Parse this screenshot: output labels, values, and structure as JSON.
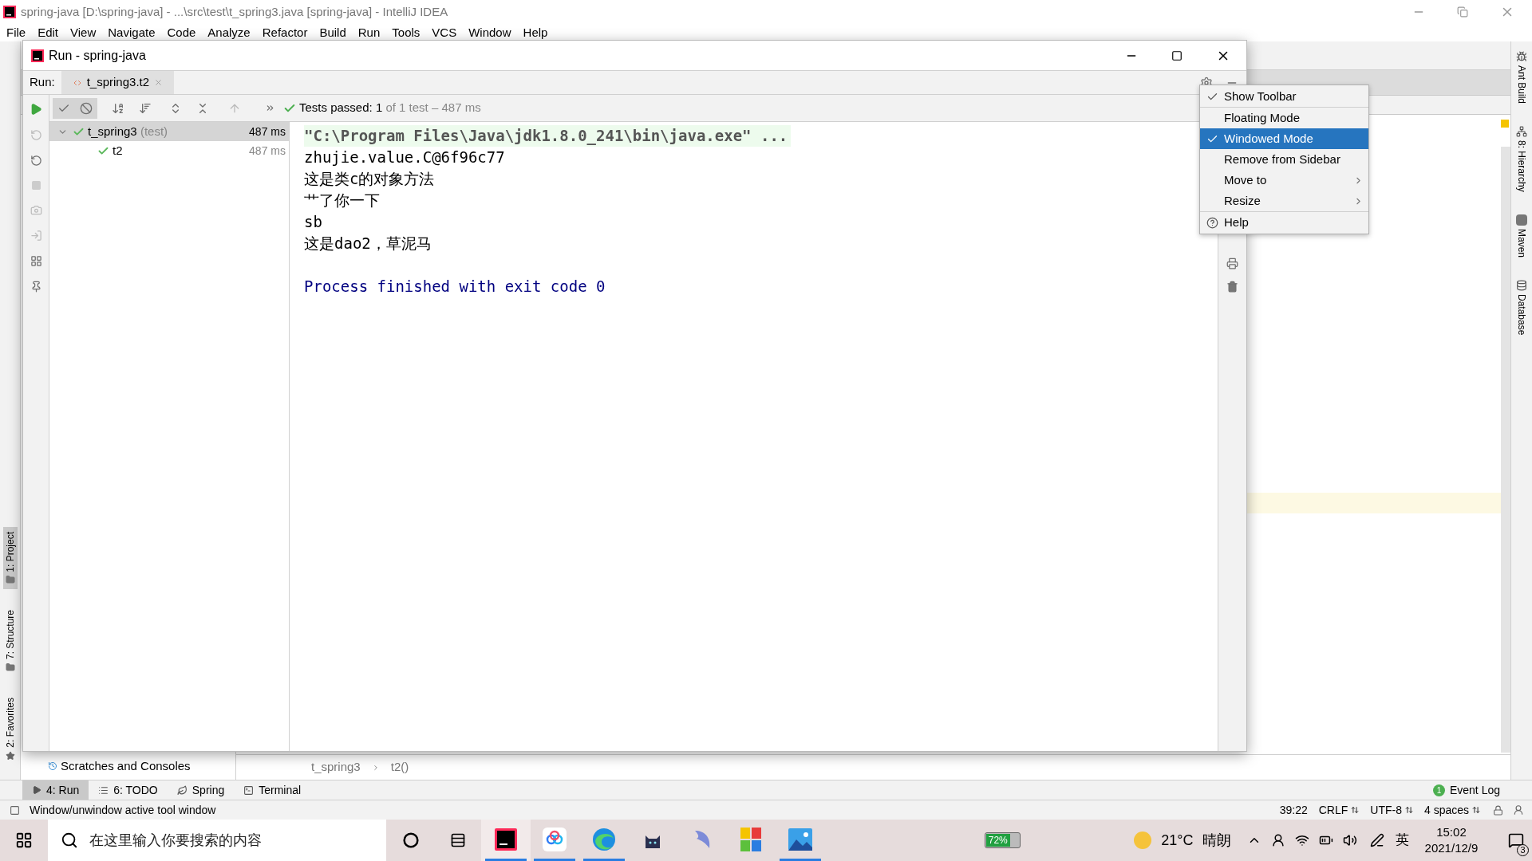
{
  "window": {
    "title": "spring-java [D:\\spring-java] - ...\\src\\test\\t_spring3.java [spring-java] - IntelliJ IDEA"
  },
  "menu": [
    "File",
    "Edit",
    "View",
    "Navigate",
    "Code",
    "Analyze",
    "Refactor",
    "Build",
    "Run",
    "Tools",
    "VCS",
    "Window",
    "Help"
  ],
  "left_stripe": [
    {
      "label": "1: Project",
      "selected": true
    },
    {
      "label": "7: Structure",
      "selected": false
    },
    {
      "label": "2: Favorites",
      "selected": false
    }
  ],
  "right_stripe": [
    {
      "label": "Ant Build",
      "kind": "ant"
    },
    {
      "label": "8: Hierarchy",
      "kind": "hierarchy"
    },
    {
      "label": "Maven",
      "kind": "maven"
    },
    {
      "label": "Database",
      "kind": "database"
    }
  ],
  "project_panel": {
    "item": "Scratches and Consoles"
  },
  "breadcrumbs": [
    "t_spring3",
    "t2()"
  ],
  "run_window": {
    "title": "Run - spring-java",
    "run_label": "Run:",
    "tabs": [
      {
        "label": "t_spring3.t2",
        "selected": true
      }
    ],
    "status": {
      "label": "Tests passed:",
      "count": "1",
      "detail": "of 1 test – 487 ms"
    },
    "tree": [
      {
        "label": "t_spring3",
        "suffix": "(test)",
        "time": "487 ms",
        "selected": true,
        "expanded": true,
        "children": [
          {
            "label": "t2",
            "time": "487 ms",
            "selected": false
          }
        ]
      }
    ],
    "console": [
      {
        "kind": "command",
        "text": "\"C:\\Program Files\\Java\\jdk1.8.0_241\\bin\\java.exe\" ..."
      },
      {
        "kind": "output",
        "text": "zhujie.value.C@6f96c77"
      },
      {
        "kind": "output",
        "text": "这是类c的对象方法"
      },
      {
        "kind": "output",
        "text": "艹了你一下"
      },
      {
        "kind": "output",
        "text": "sb"
      },
      {
        "kind": "output",
        "text": "这是dao2，草泥马"
      },
      {
        "kind": "system",
        "text": "Process finished with exit code 0"
      }
    ]
  },
  "context_menu": [
    {
      "items": [
        {
          "label": "Show Toolbar",
          "kind": "check",
          "checked": true,
          "selected": false
        }
      ]
    },
    {
      "items": [
        {
          "label": "Floating Mode",
          "kind": "check",
          "checked": false,
          "selected": false
        },
        {
          "label": "Windowed Mode",
          "kind": "check",
          "checked": true,
          "selected": true
        },
        {
          "label": "Remove from Sidebar",
          "kind": "check",
          "checked": false,
          "selected": false
        },
        {
          "label": "Move to",
          "kind": "submenu",
          "selected": false
        },
        {
          "label": "Resize",
          "kind": "submenu",
          "selected": false
        }
      ]
    },
    {
      "items": [
        {
          "label": "Help",
          "kind": "help",
          "selected": false
        }
      ]
    }
  ],
  "bottom_tabs": [
    {
      "label": "4: Run",
      "kind": "run",
      "selected": true
    },
    {
      "label": "6: TODO",
      "kind": "todo",
      "selected": false
    },
    {
      "label": "Spring",
      "kind": "spring",
      "selected": false
    },
    {
      "label": "Terminal",
      "kind": "terminal",
      "selected": false
    }
  ],
  "event_log": {
    "count": "1",
    "label": "Event Log"
  },
  "status_bar": {
    "message": "Window/unwindow active tool window",
    "position": "39:22",
    "widgets": [
      "CRLF",
      "UTF-8",
      "4 spaces"
    ]
  },
  "taskbar": {
    "search_placeholder": "在这里输入你要搜索的内容",
    "apps": [
      {
        "kind": "ide",
        "running": true,
        "selected": true
      },
      {
        "kind": "cloud",
        "running": true,
        "selected": false
      },
      {
        "kind": "browser",
        "running": true,
        "selected": false
      },
      {
        "kind": "cat",
        "running": false,
        "selected": false
      },
      {
        "kind": "dolphin",
        "running": false,
        "selected": false
      },
      {
        "kind": "tiles",
        "running": false,
        "selected": false
      },
      {
        "kind": "photos",
        "running": true,
        "selected": false
      }
    ],
    "battery": "72%",
    "temperature": "21°C",
    "weather": "晴朗",
    "ime": "英",
    "time": "15:02",
    "date": "2021/12/9",
    "notifications": "3"
  }
}
